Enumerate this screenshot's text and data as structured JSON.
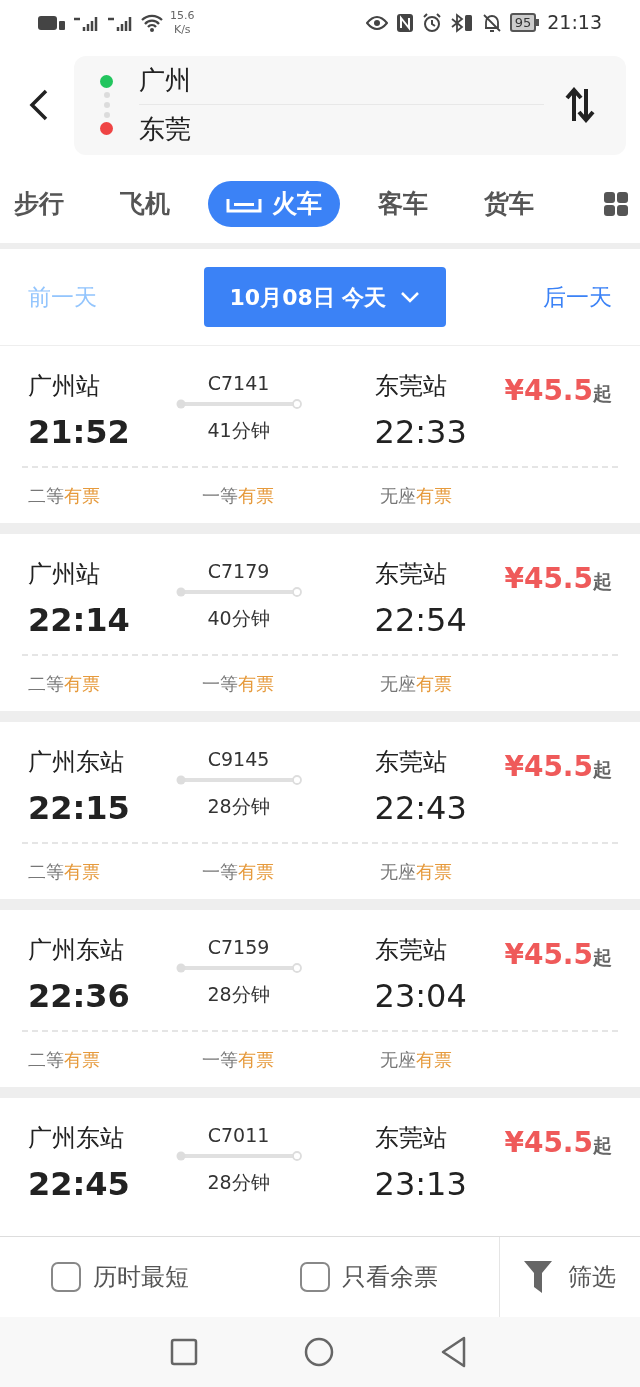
{
  "status_bar": {
    "speed": "15.6",
    "speed_unit": "K/s",
    "battery": "95",
    "time": "21:13"
  },
  "route": {
    "from": "广州",
    "to": "东莞"
  },
  "tabs": [
    {
      "label": "步行",
      "selected": false
    },
    {
      "label": "飞机",
      "selected": false
    },
    {
      "label": "火车",
      "selected": true
    },
    {
      "label": "客车",
      "selected": false
    },
    {
      "label": "货车",
      "selected": false
    }
  ],
  "date_bar": {
    "prev": {
      "label": "前一天",
      "disabled": true
    },
    "date": "10月08日 今天",
    "next": {
      "label": "后一天",
      "disabled": false
    }
  },
  "trains": [
    {
      "from_station": "广州站",
      "depart": "21:52",
      "number": "C7141",
      "duration": "41分钟",
      "to_station": "东莞站",
      "arrive": "22:33",
      "price": "¥45.5",
      "price_suffix": "起",
      "seats": [
        {
          "class": "二等",
          "status": "有票"
        },
        {
          "class": "一等",
          "status": "有票"
        },
        {
          "class": "无座",
          "status": "有票"
        }
      ]
    },
    {
      "from_station": "广州站",
      "depart": "22:14",
      "number": "C7179",
      "duration": "40分钟",
      "to_station": "东莞站",
      "arrive": "22:54",
      "price": "¥45.5",
      "price_suffix": "起",
      "seats": [
        {
          "class": "二等",
          "status": "有票"
        },
        {
          "class": "一等",
          "status": "有票"
        },
        {
          "class": "无座",
          "status": "有票"
        }
      ]
    },
    {
      "from_station": "广州东站",
      "depart": "22:15",
      "number": "C9145",
      "duration": "28分钟",
      "to_station": "东莞站",
      "arrive": "22:43",
      "price": "¥45.5",
      "price_suffix": "起",
      "seats": [
        {
          "class": "二等",
          "status": "有票"
        },
        {
          "class": "一等",
          "status": "有票"
        },
        {
          "class": "无座",
          "status": "有票"
        }
      ]
    },
    {
      "from_station": "广州东站",
      "depart": "22:36",
      "number": "C7159",
      "duration": "28分钟",
      "to_station": "东莞站",
      "arrive": "23:04",
      "price": "¥45.5",
      "price_suffix": "起",
      "seats": [
        {
          "class": "二等",
          "status": "有票"
        },
        {
          "class": "一等",
          "status": "有票"
        },
        {
          "class": "无座",
          "status": "有票"
        }
      ]
    },
    {
      "from_station": "广州东站",
      "depart": "22:45",
      "number": "C7011",
      "duration": "28分钟",
      "to_station": "东莞站",
      "arrive": "23:13",
      "price": "¥45.5",
      "price_suffix": "起"
    }
  ],
  "bottom_bar": {
    "options": [
      {
        "label": "历时最短",
        "checked": false
      },
      {
        "label": "只看余票",
        "checked": false
      }
    ],
    "filter": "筛选"
  }
}
